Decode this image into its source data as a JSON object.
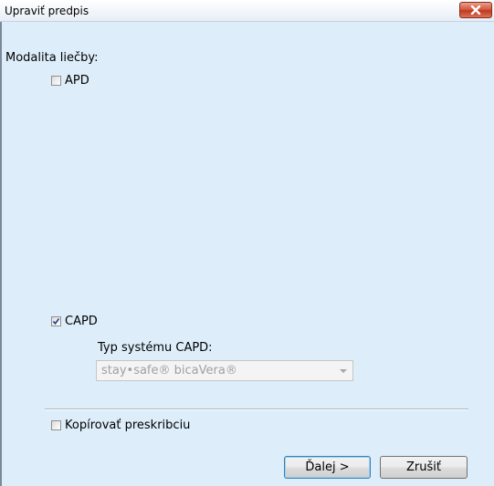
{
  "window": {
    "title": "Upraviť predpis"
  },
  "form": {
    "modality_label": "Modalita liečby:",
    "apd": {
      "label": "APD",
      "checked": false
    },
    "capd": {
      "label": "CAPD",
      "checked": true
    },
    "system_type_label": "Typ systému CAPD:",
    "system_type": {
      "value": "stay•safe® bicaVera®",
      "disabled": true
    },
    "copy_prescription": {
      "label": "Kopírovať preskribciu",
      "checked": false
    }
  },
  "buttons": {
    "next": "Ďalej >",
    "cancel": "Zrušiť"
  },
  "icons": {
    "close": "close-icon",
    "check": "check-icon",
    "dropdown": "chevron-down-icon"
  }
}
